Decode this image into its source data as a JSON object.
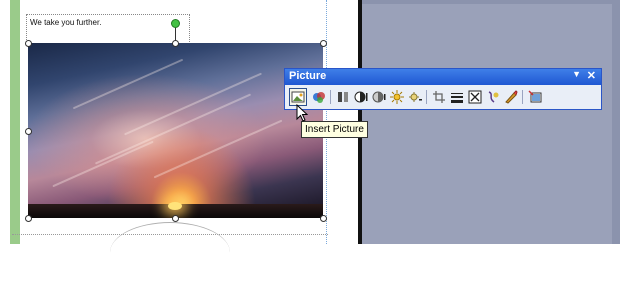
{
  "document": {
    "textbox_text": "We take you further."
  },
  "toolbar": {
    "title": "Picture",
    "dropdown_glyph": "▼",
    "close_glyph": "✕",
    "buttons": [
      {
        "name": "insert-picture-icon"
      },
      {
        "name": "color-icon"
      },
      {
        "name": "crop-icon"
      },
      {
        "name": "more-contrast-icon"
      },
      {
        "name": "less-contrast-icon"
      },
      {
        "name": "more-brightness-icon"
      },
      {
        "name": "less-brightness-icon"
      },
      {
        "name": "crop-tool-icon"
      },
      {
        "name": "line-style-icon"
      },
      {
        "name": "compress-pictures-icon"
      },
      {
        "name": "text-wrapping-icon"
      },
      {
        "name": "format-picture-icon"
      },
      {
        "name": "set-transparent-color-icon"
      },
      {
        "name": "reset-picture-icon"
      }
    ]
  },
  "tooltip": {
    "text": "Insert Picture"
  },
  "colors": {
    "toolbar_title_bg": "#1f57d2",
    "toolbar_bg": "#e9eef7",
    "tooltip_bg": "#ffffe1",
    "side_pane": "#8b93ad",
    "green_bar": "#9acb8a"
  }
}
